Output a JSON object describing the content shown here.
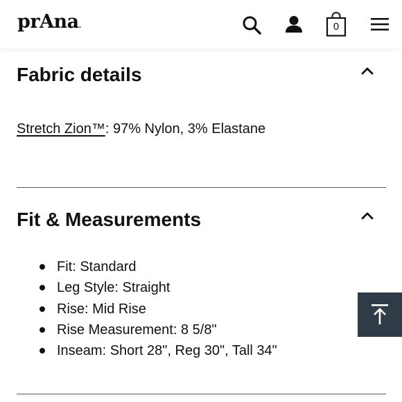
{
  "header": {
    "logo_text": "prAna",
    "logo_dot": ".",
    "cart_count": "0",
    "icons": [
      "search-icon",
      "account-icon",
      "shopping-bag-icon",
      "hamburger-menu-icon"
    ]
  },
  "sections": {
    "fabric": {
      "title": "Fabric details",
      "link_text": "Stretch Zion™",
      "body_text": ": 97% Nylon, 3% Elastane",
      "expanded_icon": "chevron-up-icon"
    },
    "fit": {
      "title": "Fit & Measurements",
      "expanded_icon": "chevron-up-icon",
      "items": [
        "Fit: Standard",
        "Leg Style: Straight",
        "Rise: Mid Rise",
        "Rise Measurement: 8 5/8\"",
        "Inseam: Short 28\", Reg 30\", Tall 34\""
      ]
    }
  },
  "back_to_top": {
    "icon": "arrow-up-to-top-icon"
  },
  "colors": {
    "text": "#111111",
    "divider": "#555555",
    "back_to_top_bg": "#2f3b47",
    "background": "#ffffff"
  }
}
